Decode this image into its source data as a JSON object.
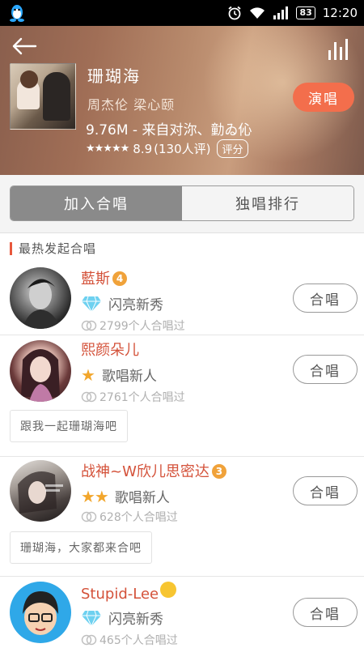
{
  "status_bar": {
    "battery": "83",
    "time": "12:20"
  },
  "song": {
    "title": "珊瑚海",
    "singers": "周杰伦  梁心颐",
    "meta": "9.76M - 来自对沵、勭ゐ伈",
    "rating": "8.9",
    "rating_count": "(130人评)",
    "rate_label": "评分",
    "sing_label": "演唱"
  },
  "tabs": [
    {
      "label": "加入合唱",
      "active": true
    },
    {
      "label": "独唱排行",
      "active": false
    }
  ],
  "section_title": "最热发起合唱",
  "chorus_list": [
    {
      "name": "藍斯",
      "badge": "4",
      "level": "闪亮新秀",
      "count": "2799个人合唱过",
      "join_label": "合唱"
    },
    {
      "name": "熙颜朵儿",
      "level": "歌唱新人",
      "count": "2761个人合唱过",
      "join_label": "合唱",
      "message": "跟我一起珊瑚海吧"
    },
    {
      "name": "战神~W欣儿思密达",
      "badge": "3",
      "level": "歌唱新人",
      "count": "628个人合唱过",
      "join_label": "合唱",
      "message": "珊瑚海，大家都来合吧"
    },
    {
      "name": "Stupid-Lee",
      "level": "闪亮新秀",
      "count": "465个人合唱过",
      "join_label": "合唱"
    }
  ],
  "colors": {
    "accent": "#f36e4c",
    "name": "#d4523a",
    "tab_active": "#8a8a8a"
  }
}
